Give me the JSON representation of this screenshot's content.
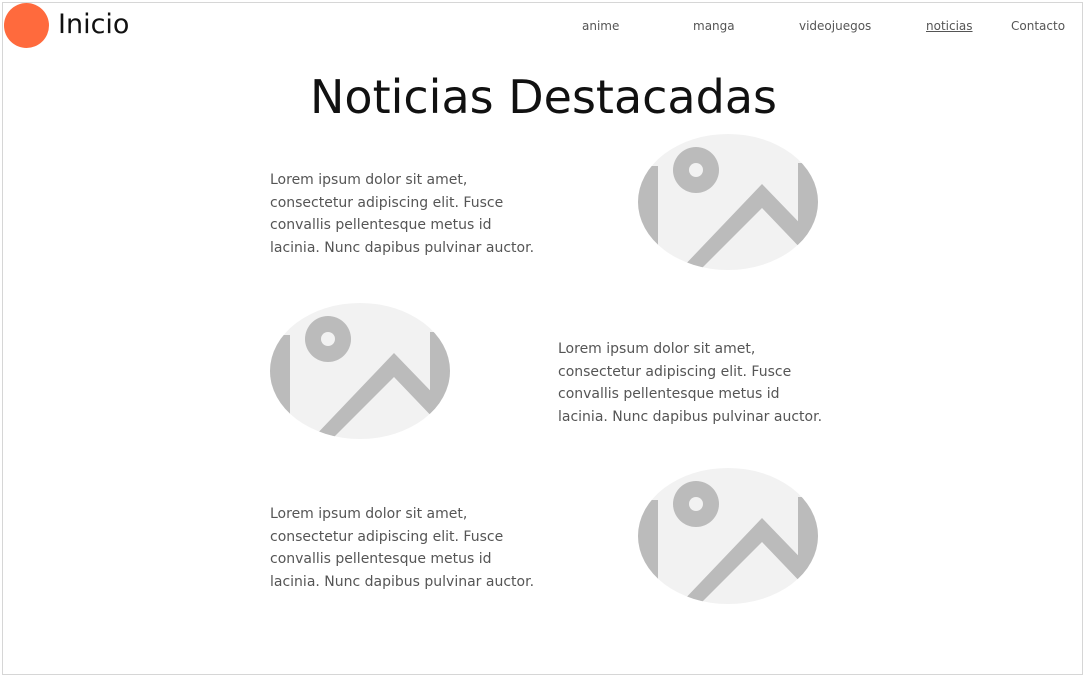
{
  "header": {
    "brand_label": "Inicio",
    "nav": [
      {
        "label": "anime"
      },
      {
        "label": "manga"
      },
      {
        "label": "videojuegos"
      },
      {
        "label": "noticias",
        "active": true
      },
      {
        "label": "Contacto"
      }
    ]
  },
  "main": {
    "title": "Noticias Destacadas",
    "articles": [
      {
        "text": "Lorem ipsum dolor sit amet, consectetur adipiscing elit. Fusce convallis pellentesque metus id lacinia. Nunc dapibus pulvinar auctor.",
        "image_icon": "image-placeholder-icon"
      },
      {
        "text": "Lorem ipsum dolor sit amet, consectetur adipiscing elit. Fusce convallis pellentesque metus id lacinia. Nunc dapibus pulvinar auctor.",
        "image_icon": "image-placeholder-icon"
      },
      {
        "text": "Lorem ipsum dolor sit amet, consectetur adipiscing elit. Fusce convallis pellentesque metus id lacinia. Nunc dapibus pulvinar auctor.",
        "image_icon": "image-placeholder-icon"
      }
    ]
  },
  "colors": {
    "accent": "#ff6a3d",
    "placeholder_bg": "#f2f2f2",
    "placeholder_fg": "#bbbbbb",
    "text": "#555555",
    "heading": "#111111"
  }
}
